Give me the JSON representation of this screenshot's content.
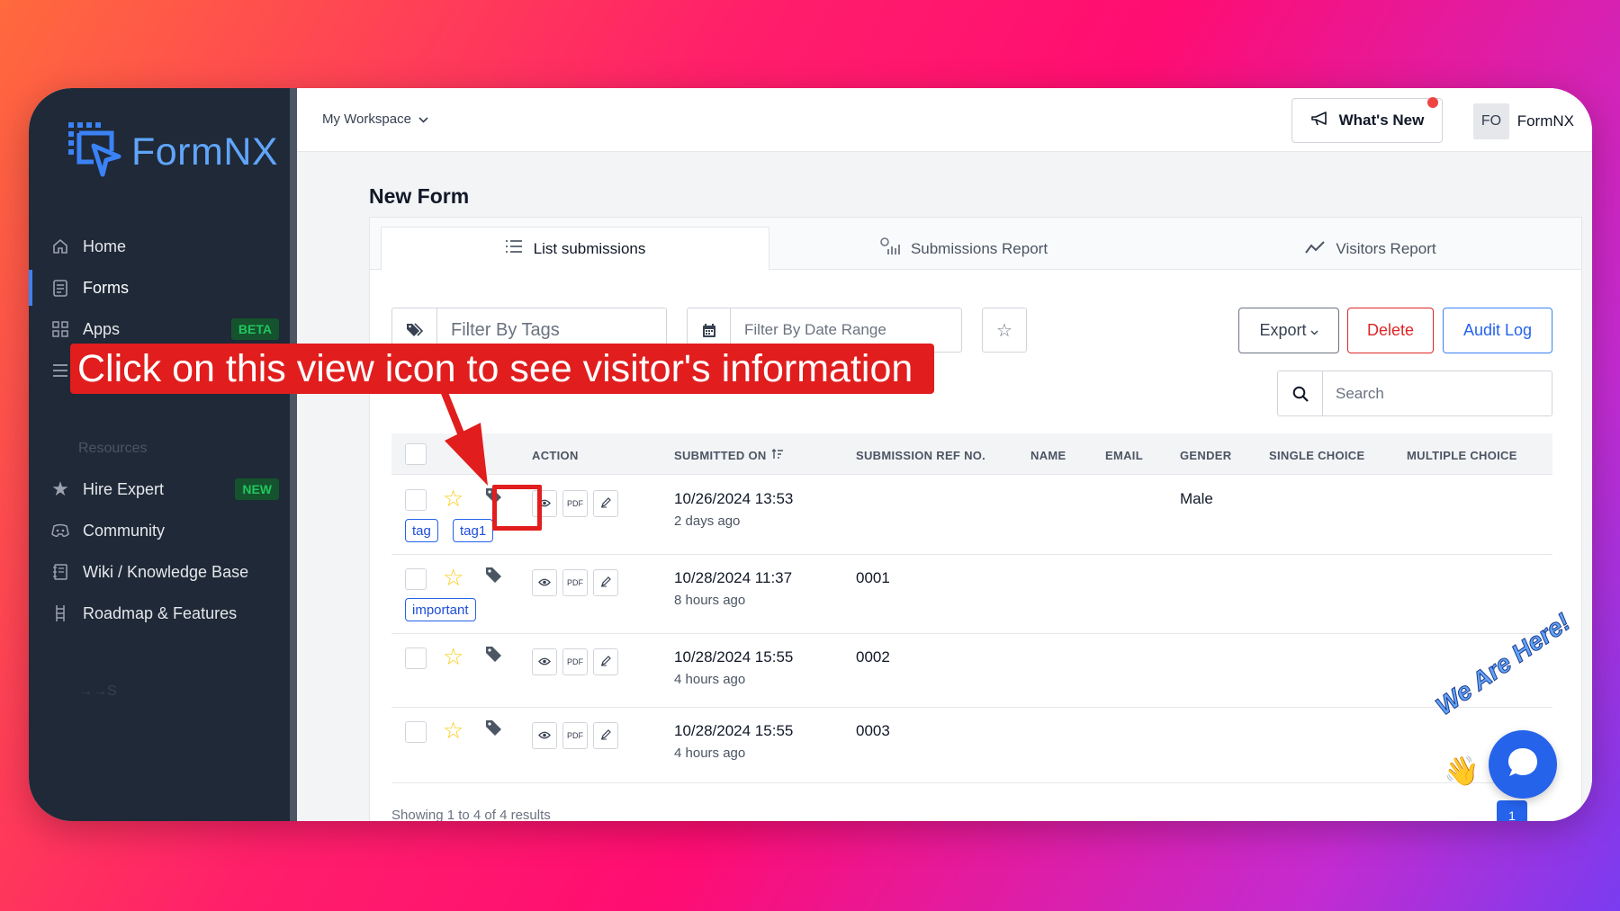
{
  "sidebar": {
    "logo": "FormNX",
    "items": [
      {
        "label": "Home",
        "icon": "home-icon"
      },
      {
        "label": "Forms",
        "icon": "document-icon"
      },
      {
        "label": "Apps",
        "icon": "apps-icon",
        "badge": "BETA"
      },
      {
        "label": "",
        "icon": "menu-icon"
      }
    ],
    "resources_label": "Resources",
    "resource_items": [
      {
        "label": "Hire Expert",
        "icon": "star-icon",
        "badge": "NEW"
      },
      {
        "label": "Community",
        "icon": "discord-icon"
      },
      {
        "label": "Wiki / Knowledge Base",
        "icon": "wiki-icon"
      },
      {
        "label": "Roadmap & Features",
        "icon": "roadmap-icon"
      }
    ],
    "faded_item": "→→S"
  },
  "topbar": {
    "workspace": "My Workspace",
    "whats_new": "What's New",
    "avatar": "FO",
    "user": "FormNX"
  },
  "page": {
    "title": "New Form",
    "tabs": [
      "List submissions",
      "Submissions Report",
      "Visitors Report"
    ],
    "filter_tags_placeholder": "Filter By Tags",
    "filter_date_placeholder": "Filter By Date Range",
    "export": "Export",
    "delete": "Delete",
    "audit_log": "Audit Log",
    "search_placeholder": "Search"
  },
  "table": {
    "headers": [
      "ACTION",
      "SUBMITTED ON",
      "SUBMISSION REF NO.",
      "NAME",
      "EMAIL",
      "GENDER",
      "SINGLE CHOICE",
      "MULTIPLE CHOICE"
    ],
    "rows": [
      {
        "tags": [
          "tag",
          "tag1"
        ],
        "date": "10/26/2024 13:53",
        "rel": "2 days ago",
        "ref": "",
        "gender": "Male"
      },
      {
        "tags": [
          "important"
        ],
        "date": "10/28/2024 11:37",
        "rel": "8 hours ago",
        "ref": "0001",
        "gender": ""
      },
      {
        "tags": [],
        "date": "10/28/2024 15:55",
        "rel": "4 hours ago",
        "ref": "0002",
        "gender": ""
      },
      {
        "tags": [],
        "date": "10/28/2024 15:55",
        "rel": "4 hours ago",
        "ref": "0003",
        "gender": ""
      }
    ],
    "pdf_label": "PDF",
    "footer": "Showing 1 to 4 of 4 results",
    "page": "1"
  },
  "annotation": {
    "callout": "Click on this view icon to see visitor's information"
  },
  "chat": {
    "label": "We Are Here!"
  },
  "colors": {
    "sidebar_bg": "#1f2937",
    "accent": "#2563eb",
    "annotation": "#e11d1d"
  }
}
